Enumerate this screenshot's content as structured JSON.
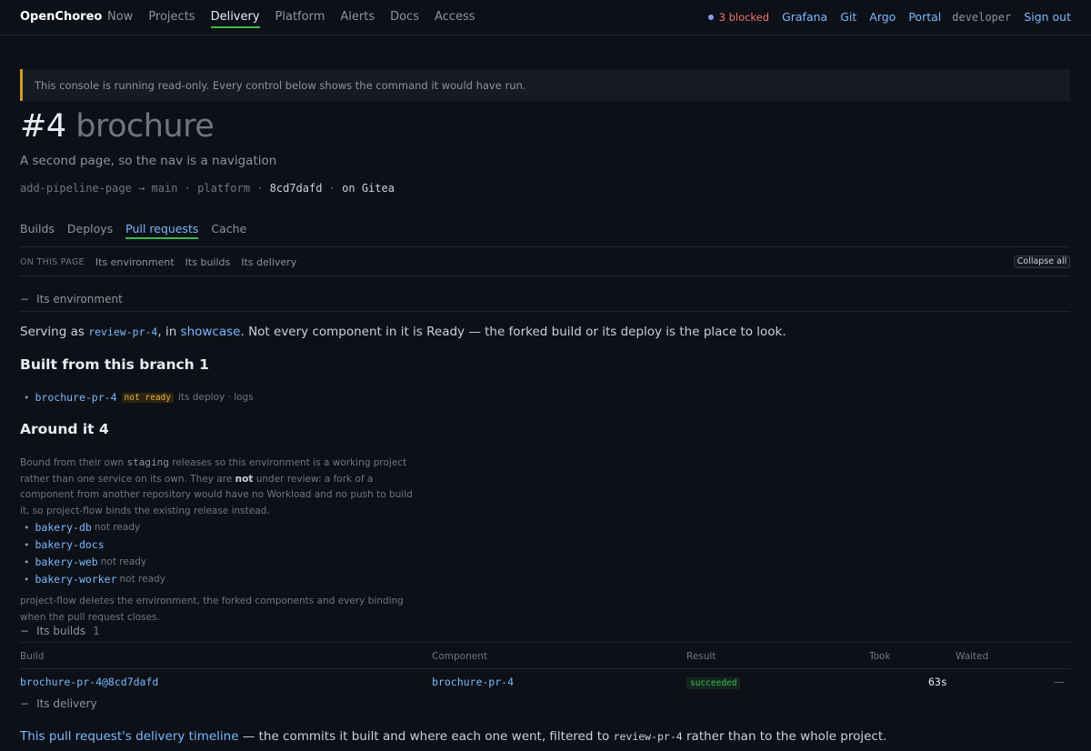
{
  "nav": {
    "brand": "OpenChoreo",
    "links": [
      "Now",
      "Projects",
      "Delivery",
      "Platform",
      "Alerts",
      "Docs",
      "Access"
    ],
    "active_index": 2,
    "blocked": "3 blocked",
    "right_links": [
      "Grafana",
      "Git",
      "Argo",
      "Portal"
    ],
    "user": "developer",
    "signout": "Sign out"
  },
  "banner": "This console is running read-only. Every control below shows the command it would have run.",
  "header": {
    "number": "#4",
    "name": "brochure",
    "subtitle": "A second page, so the nav is a navigation",
    "branch": "add-pipeline-page",
    "arrow": "→",
    "target": "main",
    "sep": "·",
    "project": "platform",
    "commit": "8cd7dafd",
    "host": "on Gitea"
  },
  "tabs": [
    "Builds",
    "Deploys",
    "Pull requests",
    "Cache"
  ],
  "onpage": {
    "label": "ON THIS PAGE",
    "links": [
      "Its environment",
      "Its builds",
      "Its delivery"
    ],
    "collapse": "Collapse all"
  },
  "environment": {
    "heading": "Its environment",
    "minus": "−",
    "lead_1": "Serving as ",
    "env": "review-pr-4",
    "lead_2": ", in ",
    "project_link": "showcase",
    "lead_3": ". Not every component in it is Ready — the forked build or its deploy is the place to look.",
    "built_heading": "Built from this branch 1",
    "built_item": {
      "name": "brochure-pr-4",
      "status": "not ready",
      "deploy": "its deploy",
      "dot": "·",
      "logs": "logs"
    },
    "around_heading": "Around it 4",
    "para_1": "Bound from their own ",
    "para_code": "staging",
    "para_2": " releases so this environment is a working project rather than one service on its own. They are ",
    "para_bold": "not",
    "para_3": " under review: a fork of a component from another repository would have no Workload and no push to build it, so project-flow binds the existing release instead.",
    "around_items": [
      {
        "name": "bakery-db",
        "status": "not ready"
      },
      {
        "name": "bakery-docs",
        "status": ""
      },
      {
        "name": "bakery-web",
        "status": "not ready"
      },
      {
        "name": "bakery-worker",
        "status": "not ready"
      }
    ],
    "closing": "project-flow deletes the environment, the forked components and every binding when the pull request closes."
  },
  "builds": {
    "heading": "Its builds",
    "count": "1",
    "columns": [
      "Build",
      "Component",
      "Result",
      "Took",
      "Waited"
    ],
    "rows": [
      {
        "build": "brochure-pr-4@8cd7dafd",
        "component": "brochure-pr-4",
        "result": "succeeded",
        "took": "63s",
        "waited": "—"
      }
    ]
  },
  "delivery": {
    "heading": "Its delivery",
    "link": "This pull request's delivery timeline",
    "text_1": " — the commits it built and where each one went, filtered to ",
    "env": "review-pr-4",
    "text_2": " rather than to the whole project."
  }
}
